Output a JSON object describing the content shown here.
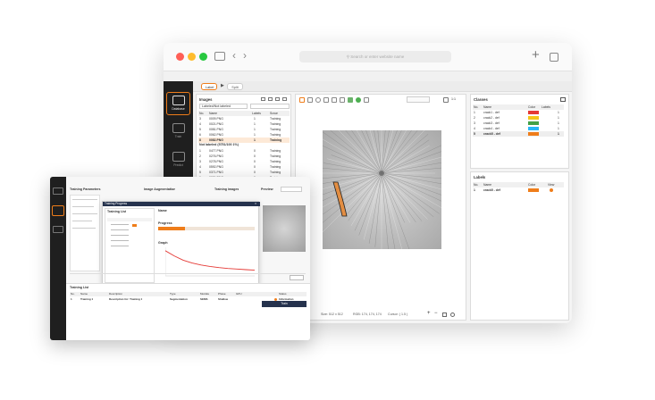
{
  "browser": {
    "url_placeholder": "Search or enter website name",
    "traffic_colors": [
      "#ff5f57",
      "#febc2e",
      "#28c840"
    ]
  },
  "app": {
    "tabs": [
      "Label",
      "Split"
    ],
    "sidebar": [
      "Database",
      "Train",
      "Predict"
    ]
  },
  "images_panel": {
    "title": "Images",
    "filter": "Labeled/Not labeled",
    "columns": [
      "No.",
      "Name",
      "Labels",
      "Scrue"
    ],
    "rows": [
      {
        "no": "3",
        "name": "0009.PNG",
        "labels": "1",
        "scrue": "Training"
      },
      {
        "no": "4",
        "name": "0021.PNG",
        "labels": "1",
        "scrue": "Training"
      },
      {
        "no": "5",
        "name": "0081.PNG",
        "labels": "1",
        "scrue": "Training"
      },
      {
        "no": "6",
        "name": "0062.PNG",
        "labels": "1",
        "scrue": "Training"
      },
      {
        "no": "8",
        "name": "0082.PNG",
        "labels": "1",
        "scrue": "Training"
      }
    ],
    "not_labeled_header": "Not labeled (5751/100 1%)",
    "not_labeled_rows": [
      {
        "no": "1",
        "name": "0477.PNG",
        "labels": "0",
        "scrue": "Training"
      },
      {
        "no": "2",
        "name": "0276.PNG",
        "labels": "0",
        "scrue": "Training"
      },
      {
        "no": "3",
        "name": "0278.PNG",
        "labels": "0",
        "scrue": "Training"
      },
      {
        "no": "4",
        "name": "0592.PNG",
        "labels": "0",
        "scrue": "Training"
      },
      {
        "no": "5",
        "name": "0371.PNG",
        "labels": "0",
        "scrue": "Training"
      },
      {
        "no": "6",
        "name": "0081.PNG",
        "labels": "0",
        "scrue": "Training"
      }
    ]
  },
  "canvas": {
    "status_size": "Size: 512 x 512",
    "status_rgb": "RGB: 174, 174, 174",
    "status_cursor": "Cursor: ( 1.5 )",
    "zoom_text": "1:1"
  },
  "classes_panel": {
    "title": "Classes",
    "columns": [
      "No.",
      "Name",
      "Color",
      "Labels"
    ],
    "rows": [
      {
        "no": "1",
        "name": "crack1 - def",
        "color": "#e53935",
        "labels": "1"
      },
      {
        "no": "2",
        "name": "crack2 - def",
        "color": "#f5c518",
        "labels": "1"
      },
      {
        "no": "3",
        "name": "crack3 - def",
        "color": "#43a047",
        "labels": "1"
      },
      {
        "no": "4",
        "name": "crack4 - def",
        "color": "#29b6f6",
        "labels": "1"
      },
      {
        "no": "5",
        "name": "crack5 - def",
        "color": "#ef7d1a",
        "labels": "1"
      }
    ]
  },
  "labels_panel": {
    "title": "Labels",
    "columns": [
      "No.",
      "Name",
      "Color",
      "View"
    ],
    "rows": [
      {
        "no": "1",
        "name": "crack5 - def",
        "color": "#ef7d1a"
      }
    ]
  },
  "training_window": {
    "sections": [
      "Training Parameters",
      "Image Augmentation",
      "Training images",
      "Preview"
    ],
    "dialog_title": "Training Progress",
    "list_title": "Training List",
    "name_label": "Name",
    "progress_label": "Progress",
    "loss_label": "Graph",
    "train_button": "Train",
    "footer_title": "Training List",
    "footer_columns": [
      "No.",
      "Name",
      "Description",
      "Type",
      "Modula",
      "Phase",
      "GPU",
      "Status"
    ],
    "footer_row": {
      "no": "1",
      "name": "Training 1",
      "desc": "Description for: Training 1",
      "type": "Segmentation",
      "modula": "SEMS",
      "phase": "Shallow",
      "status": "Information"
    }
  },
  "accent": "#ef7d1a",
  "loss_curve": [
    0.88,
    0.7,
    0.55,
    0.45,
    0.38,
    0.33,
    0.29,
    0.26,
    0.24,
    0.22,
    0.2
  ]
}
